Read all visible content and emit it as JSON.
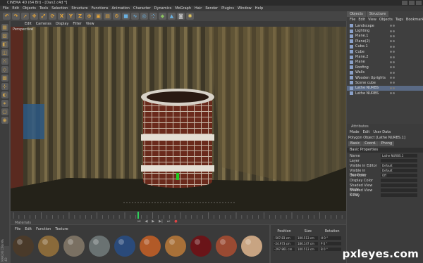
{
  "window": {
    "title": "CINEMA 4D (64 Bit) - [Dan2.c4d *]"
  },
  "menubar": [
    "File",
    "Edit",
    "Objects",
    "Tools",
    "Selection",
    "Structure",
    "Functions",
    "Animation",
    "Character",
    "Dynamics",
    "MoGraph",
    "Hair",
    "Render",
    "Plugins",
    "Window",
    "Help"
  ],
  "toolbar": {
    "icons": [
      "undo-icon",
      "redo-icon",
      "live-select-icon",
      "move-icon",
      "scale-icon",
      "rotate-icon",
      "x-axis-icon",
      "y-axis-icon",
      "z-axis-icon",
      "coordinate-system-icon",
      "render-view-icon",
      "render-picture-queue-icon",
      "render-settings-icon",
      "cube-primitive-icon",
      "spline-icon",
      "nurbs-icon",
      "array-icon",
      "deformer-icon",
      "scene-icon",
      "camera-icon",
      "light-icon"
    ],
    "labels": {
      "x": "X",
      "y": "Y",
      "z": "Z"
    }
  },
  "viewport": {
    "menu": [
      "Edit",
      "Cameras",
      "Display",
      "Filter",
      "View"
    ],
    "label": "Perspective"
  },
  "objects_panel": {
    "tabs": [
      "Objects",
      "Structure"
    ],
    "menu": [
      "File",
      "Edit",
      "View",
      "Objects",
      "Tags",
      "Bookmarks"
    ],
    "items": [
      {
        "name": "Landscape",
        "selected": false
      },
      {
        "name": "Lighting",
        "selected": false
      },
      {
        "name": "Plane.1",
        "selected": false
      },
      {
        "name": "Plane(2)",
        "selected": false
      },
      {
        "name": "Cube.1",
        "selected": false
      },
      {
        "name": "Cube",
        "selected": false
      },
      {
        "name": "Plane.2",
        "selected": false
      },
      {
        "name": "Plane",
        "selected": false
      },
      {
        "name": "Roofing",
        "selected": false
      },
      {
        "name": "Walls",
        "selected": false
      },
      {
        "name": "Wooden Uprights",
        "selected": false
      },
      {
        "name": "Scene cube",
        "selected": false
      },
      {
        "name": "Lathe NURBS",
        "selected": true
      },
      {
        "name": "Lathe NURBS",
        "selected": false
      }
    ]
  },
  "attributes_panel": {
    "title": "Attributes",
    "menu": [
      "Mode",
      "Edit",
      "User Data"
    ],
    "object": "Polygon Object [Lathe NURBS.1]",
    "tabs": [
      "Basic",
      "Coord.",
      "Phong"
    ],
    "section": "Basic Properties",
    "rows": [
      {
        "label": "Name",
        "value": "Lathe NURBS.1"
      },
      {
        "label": "Layer",
        "value": ""
      },
      {
        "label": "Visible in Editor",
        "value": "Default"
      },
      {
        "label": "Visible in Renderer",
        "value": "Default"
      },
      {
        "label": "Use Color",
        "value": "Off"
      },
      {
        "label": "Display Color",
        "value": ""
      },
      {
        "label": "Shaded View Mode",
        "value": ""
      },
      {
        "label": "Shaded View Color",
        "value": ""
      },
      {
        "label": "X-Ray",
        "value": ""
      }
    ]
  },
  "materials_panel": {
    "title": "Materials",
    "menu": [
      "File",
      "Edit",
      "Function",
      "Texture"
    ],
    "swatches": [
      "#4a3a2a",
      "#8a6a3a",
      "#7a7062",
      "#6a7272",
      "#2a4a7a",
      "#b25a28",
      "#a87038",
      "#6a1418",
      "#9a4a32",
      "#c8a482"
    ]
  },
  "coordinates_panel": {
    "headers": [
      "Position",
      "Size",
      "Rotation"
    ],
    "rows": [
      {
        "axis": "X",
        "pos": "-507.83 cm",
        "size": "100.513 cm",
        "rot": "H 0 °"
      },
      {
        "axis": "Y",
        "pos": "-24.973 cm",
        "size": "186.147 cm",
        "rot": "P 0 °"
      },
      {
        "axis": "Z",
        "pos": "-297.861 cm",
        "size": "100.513 cm",
        "rot": "B 0 °"
      }
    ]
  },
  "watermark": "pxleyes.com",
  "logo": "MAXON CINEMA 4D"
}
